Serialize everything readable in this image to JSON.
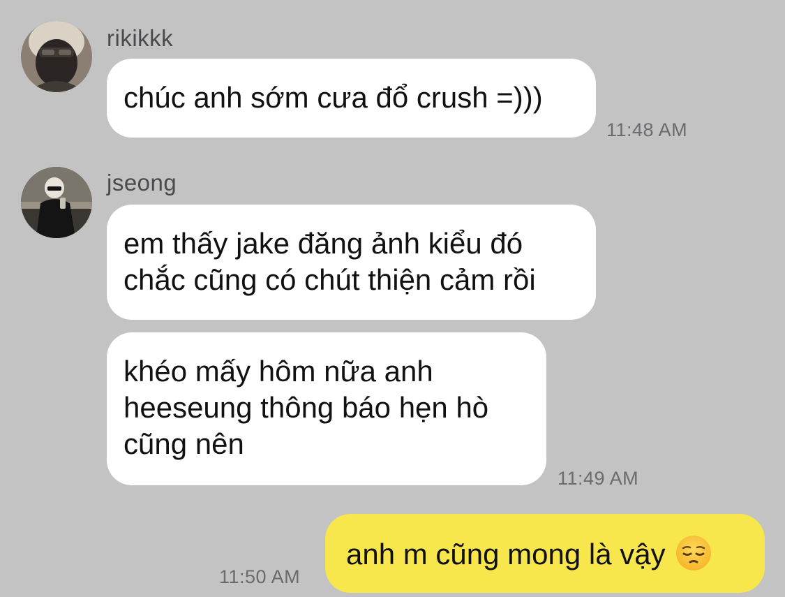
{
  "messages": [
    {
      "sender": "rikikkk",
      "avatar": "avatar-rikikkk",
      "text_lines": [
        "chúc anh sớm cưa đổ crush =)))"
      ],
      "time": "11:48 AM",
      "direction": "incoming"
    },
    {
      "sender": "jseong",
      "avatar": "avatar-jseong",
      "text_lines": [
        "em thấy jake đăng ảnh kiểu đó",
        "chắc cũng có chút thiện cảm rồi"
      ],
      "direction": "incoming"
    },
    {
      "sender": "jseong",
      "text_lines": [
        "khéo mấy hôm nữa anh",
        "heeseung thông báo hẹn hò",
        "cũng nên"
      ],
      "time": "11:49 AM",
      "direction": "incoming"
    },
    {
      "text_lines": [
        "anh m cũng mong là vậy"
      ],
      "emoji": "pensive-face",
      "time": "11:50 AM",
      "direction": "outgoing"
    }
  ],
  "colors": {
    "background": "#c3c3c4",
    "incoming_bubble": "#ffffff",
    "outgoing_bubble": "#f8e64d",
    "timestamp": "#6b6b6e",
    "sender_name": "#4a4a4c"
  }
}
